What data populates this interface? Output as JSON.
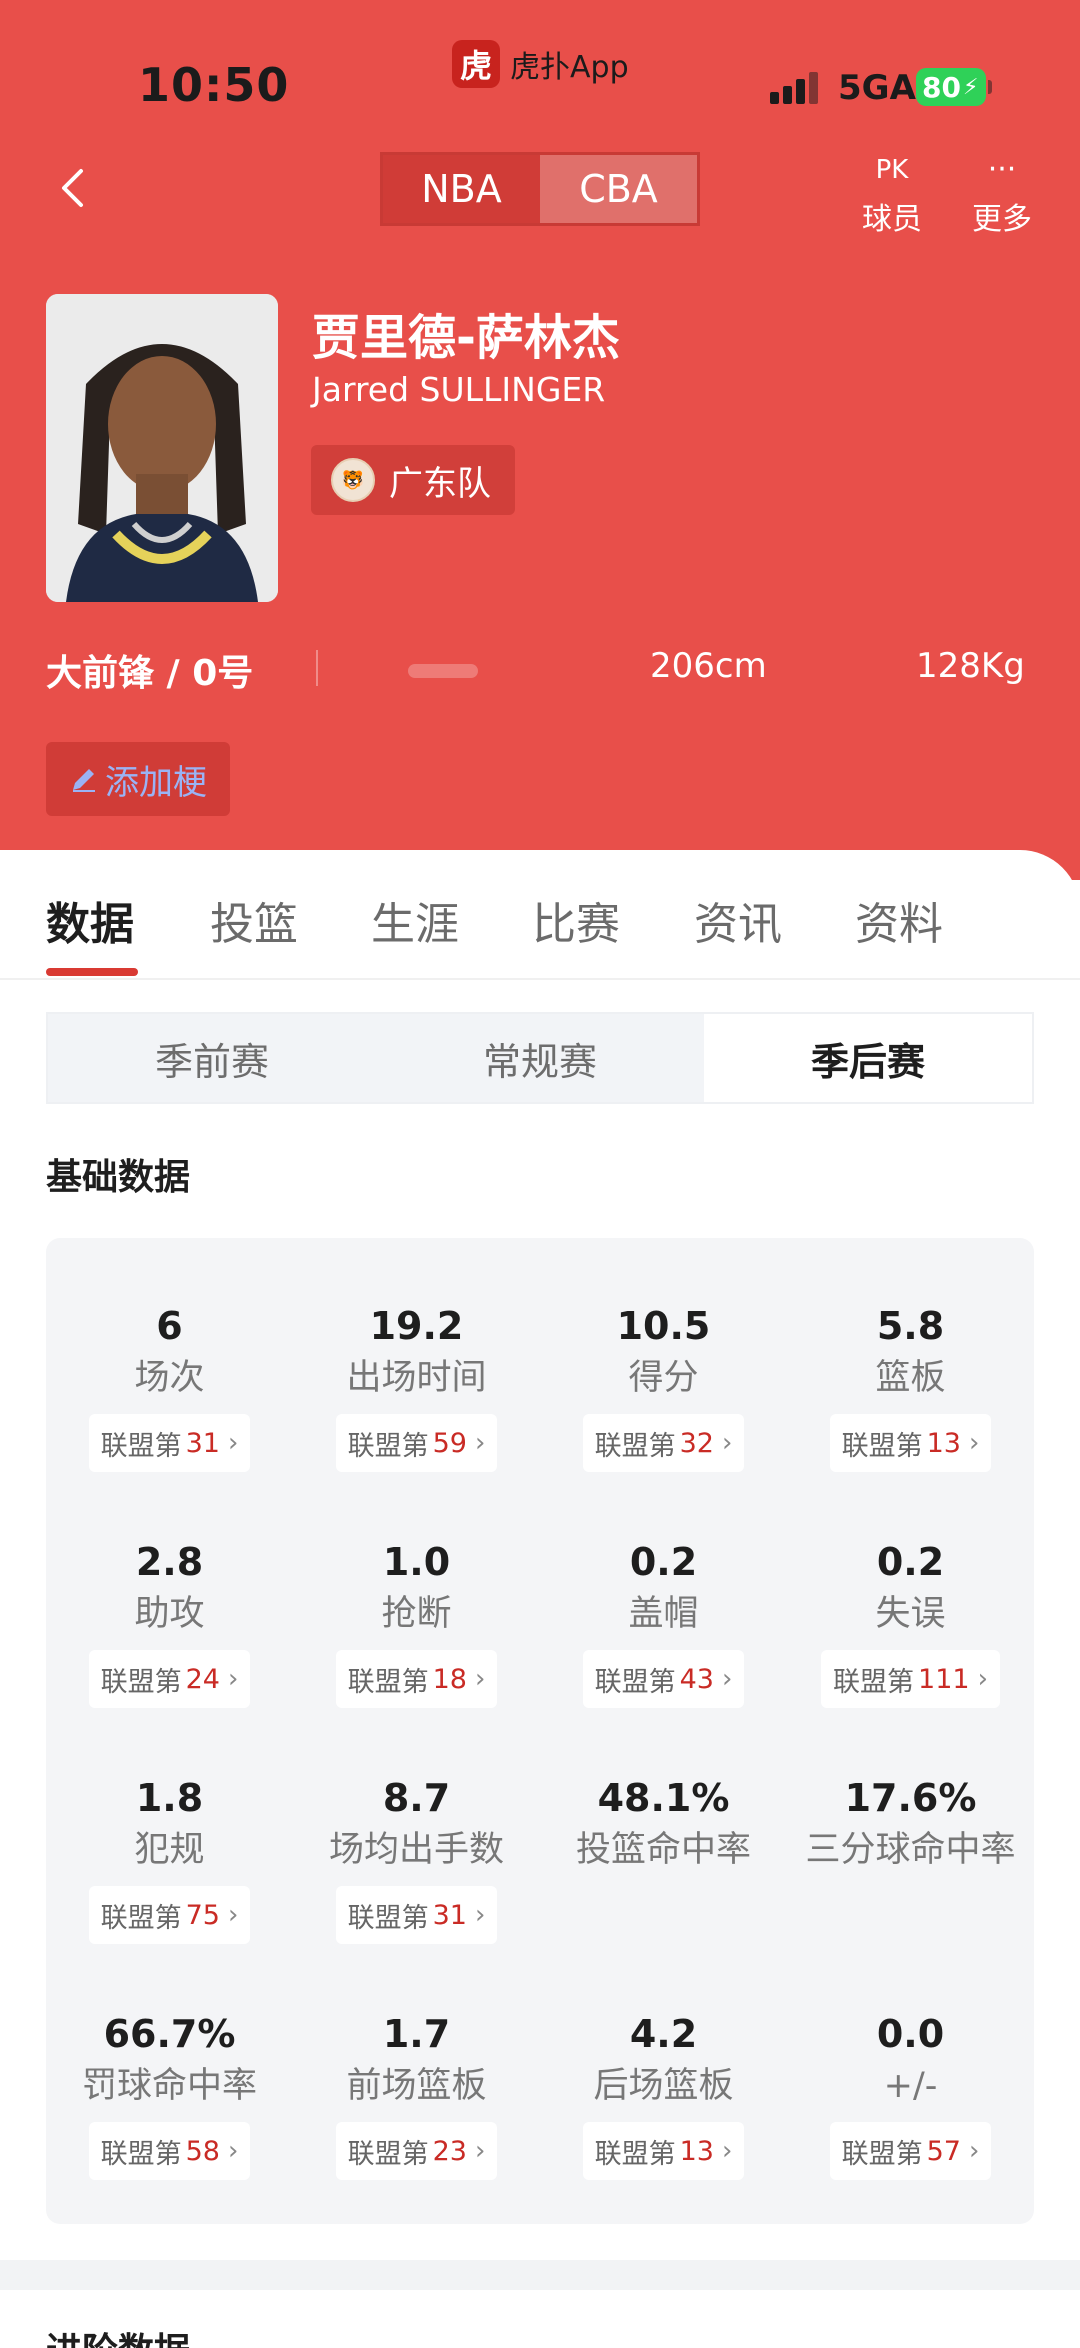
{
  "status_bar": {
    "time": "10:50",
    "app_name": "虎扑App",
    "app_logo_char": "虎",
    "network": "5GA",
    "battery": "80"
  },
  "nav": {
    "league_tabs": [
      "NBA",
      "CBA"
    ],
    "actions": [
      {
        "icon": "pk-icon",
        "glyph": "PK",
        "label": "球员"
      },
      {
        "icon": "more-icon",
        "glyph": "···",
        "label": "更多"
      }
    ]
  },
  "player": {
    "name_cn": "贾里德-萨林杰",
    "name_en": "Jarred SULLINGER",
    "team": "广东队",
    "position_number": "大前锋 / 0号",
    "height": "206cm",
    "weight": "128Kg",
    "add_meme_label": "添加梗"
  },
  "colors": {
    "header_red": "#e84f4a",
    "rank_red": "#c92b25",
    "accent_underline": "#d93a33"
  },
  "tabs": [
    "数据",
    "投篮",
    "生涯",
    "比赛",
    "资讯",
    "资料"
  ],
  "seasons": [
    "季前赛",
    "常规赛",
    "季后赛"
  ],
  "section_basic": "基础数据",
  "rank_prefix": "联盟第",
  "stats": [
    {
      "value": "6",
      "label": "场次",
      "rank": "31"
    },
    {
      "value": "19.2",
      "label": "出场时间",
      "rank": "59"
    },
    {
      "value": "10.5",
      "label": "得分",
      "rank": "32"
    },
    {
      "value": "5.8",
      "label": "篮板",
      "rank": "13"
    },
    {
      "value": "2.8",
      "label": "助攻",
      "rank": "24"
    },
    {
      "value": "1.0",
      "label": "抢断",
      "rank": "18"
    },
    {
      "value": "0.2",
      "label": "盖帽",
      "rank": "43"
    },
    {
      "value": "0.2",
      "label": "失误",
      "rank": "111"
    },
    {
      "value": "1.8",
      "label": "犯规",
      "rank": "75"
    },
    {
      "value": "8.7",
      "label": "场均出手数",
      "rank": "31"
    },
    {
      "value": "48.1%",
      "label": "投篮命中率",
      "rank": ""
    },
    {
      "value": "17.6%",
      "label": "三分球命中率",
      "rank": ""
    },
    {
      "value": "66.7%",
      "label": "罚球命中率",
      "rank": "58"
    },
    {
      "value": "1.7",
      "label": "前场篮板",
      "rank": "23"
    },
    {
      "value": "4.2",
      "label": "后场篮板",
      "rank": "13"
    },
    {
      "value": "0.0",
      "label": "+/-",
      "rank": "57"
    }
  ],
  "section_advanced": "进阶数据"
}
